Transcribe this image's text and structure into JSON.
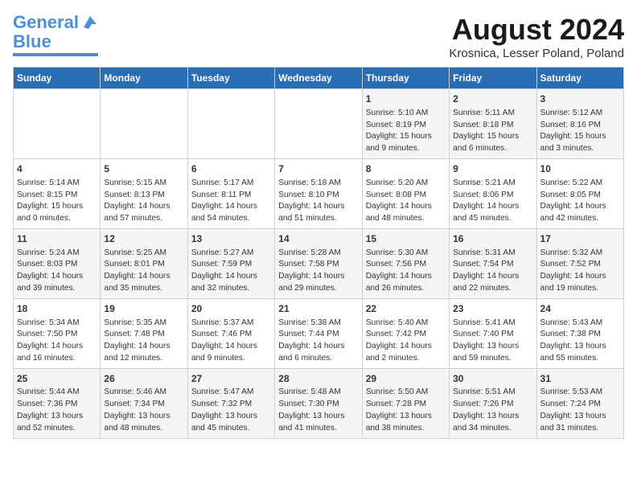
{
  "logo": {
    "line1": "General",
    "line2": "Blue"
  },
  "title": "August 2024",
  "subtitle": "Krosnica, Lesser Poland, Poland",
  "days_header": [
    "Sunday",
    "Monday",
    "Tuesday",
    "Wednesday",
    "Thursday",
    "Friday",
    "Saturday"
  ],
  "weeks": [
    [
      {
        "day": "",
        "content": ""
      },
      {
        "day": "",
        "content": ""
      },
      {
        "day": "",
        "content": ""
      },
      {
        "day": "",
        "content": ""
      },
      {
        "day": "1",
        "content": "Sunrise: 5:10 AM\nSunset: 8:19 PM\nDaylight: 15 hours\nand 9 minutes."
      },
      {
        "day": "2",
        "content": "Sunrise: 5:11 AM\nSunset: 8:18 PM\nDaylight: 15 hours\nand 6 minutes."
      },
      {
        "day": "3",
        "content": "Sunrise: 5:12 AM\nSunset: 8:16 PM\nDaylight: 15 hours\nand 3 minutes."
      }
    ],
    [
      {
        "day": "4",
        "content": "Sunrise: 5:14 AM\nSunset: 8:15 PM\nDaylight: 15 hours\nand 0 minutes."
      },
      {
        "day": "5",
        "content": "Sunrise: 5:15 AM\nSunset: 8:13 PM\nDaylight: 14 hours\nand 57 minutes."
      },
      {
        "day": "6",
        "content": "Sunrise: 5:17 AM\nSunset: 8:11 PM\nDaylight: 14 hours\nand 54 minutes."
      },
      {
        "day": "7",
        "content": "Sunrise: 5:18 AM\nSunset: 8:10 PM\nDaylight: 14 hours\nand 51 minutes."
      },
      {
        "day": "8",
        "content": "Sunrise: 5:20 AM\nSunset: 8:08 PM\nDaylight: 14 hours\nand 48 minutes."
      },
      {
        "day": "9",
        "content": "Sunrise: 5:21 AM\nSunset: 8:06 PM\nDaylight: 14 hours\nand 45 minutes."
      },
      {
        "day": "10",
        "content": "Sunrise: 5:22 AM\nSunset: 8:05 PM\nDaylight: 14 hours\nand 42 minutes."
      }
    ],
    [
      {
        "day": "11",
        "content": "Sunrise: 5:24 AM\nSunset: 8:03 PM\nDaylight: 14 hours\nand 39 minutes."
      },
      {
        "day": "12",
        "content": "Sunrise: 5:25 AM\nSunset: 8:01 PM\nDaylight: 14 hours\nand 35 minutes."
      },
      {
        "day": "13",
        "content": "Sunrise: 5:27 AM\nSunset: 7:59 PM\nDaylight: 14 hours\nand 32 minutes."
      },
      {
        "day": "14",
        "content": "Sunrise: 5:28 AM\nSunset: 7:58 PM\nDaylight: 14 hours\nand 29 minutes."
      },
      {
        "day": "15",
        "content": "Sunrise: 5:30 AM\nSunset: 7:56 PM\nDaylight: 14 hours\nand 26 minutes."
      },
      {
        "day": "16",
        "content": "Sunrise: 5:31 AM\nSunset: 7:54 PM\nDaylight: 14 hours\nand 22 minutes."
      },
      {
        "day": "17",
        "content": "Sunrise: 5:32 AM\nSunset: 7:52 PM\nDaylight: 14 hours\nand 19 minutes."
      }
    ],
    [
      {
        "day": "18",
        "content": "Sunrise: 5:34 AM\nSunset: 7:50 PM\nDaylight: 14 hours\nand 16 minutes."
      },
      {
        "day": "19",
        "content": "Sunrise: 5:35 AM\nSunset: 7:48 PM\nDaylight: 14 hours\nand 12 minutes."
      },
      {
        "day": "20",
        "content": "Sunrise: 5:37 AM\nSunset: 7:46 PM\nDaylight: 14 hours\nand 9 minutes."
      },
      {
        "day": "21",
        "content": "Sunrise: 5:38 AM\nSunset: 7:44 PM\nDaylight: 14 hours\nand 6 minutes."
      },
      {
        "day": "22",
        "content": "Sunrise: 5:40 AM\nSunset: 7:42 PM\nDaylight: 14 hours\nand 2 minutes."
      },
      {
        "day": "23",
        "content": "Sunrise: 5:41 AM\nSunset: 7:40 PM\nDaylight: 13 hours\nand 59 minutes."
      },
      {
        "day": "24",
        "content": "Sunrise: 5:43 AM\nSunset: 7:38 PM\nDaylight: 13 hours\nand 55 minutes."
      }
    ],
    [
      {
        "day": "25",
        "content": "Sunrise: 5:44 AM\nSunset: 7:36 PM\nDaylight: 13 hours\nand 52 minutes."
      },
      {
        "day": "26",
        "content": "Sunrise: 5:46 AM\nSunset: 7:34 PM\nDaylight: 13 hours\nand 48 minutes."
      },
      {
        "day": "27",
        "content": "Sunrise: 5:47 AM\nSunset: 7:32 PM\nDaylight: 13 hours\nand 45 minutes."
      },
      {
        "day": "28",
        "content": "Sunrise: 5:48 AM\nSunset: 7:30 PM\nDaylight: 13 hours\nand 41 minutes."
      },
      {
        "day": "29",
        "content": "Sunrise: 5:50 AM\nSunset: 7:28 PM\nDaylight: 13 hours\nand 38 minutes."
      },
      {
        "day": "30",
        "content": "Sunrise: 5:51 AM\nSunset: 7:26 PM\nDaylight: 13 hours\nand 34 minutes."
      },
      {
        "day": "31",
        "content": "Sunrise: 5:53 AM\nSunset: 7:24 PM\nDaylight: 13 hours\nand 31 minutes."
      }
    ]
  ]
}
